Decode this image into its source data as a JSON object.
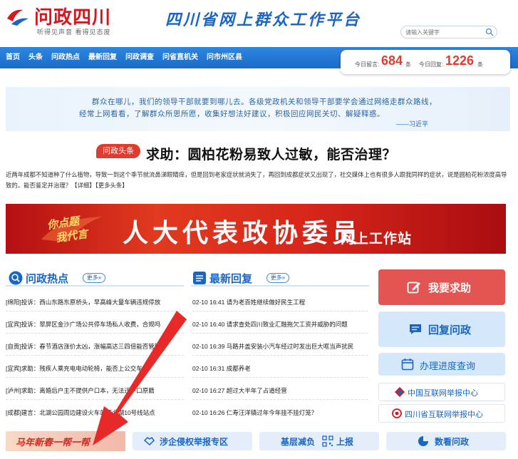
{
  "header": {
    "logo_title": "问政四川",
    "logo_sub": "听得见声音 看得见态度",
    "slogan": "四川省网上群众工作平台",
    "search_placeholder": "请输入关键字"
  },
  "nav": {
    "items": [
      "首页",
      "头条",
      "问政热点",
      "最新回复",
      "问政调查",
      "问省直机关",
      "问市州区县"
    ]
  },
  "stats": {
    "today_msg_label": "今日留言:",
    "today_msg_value": "684",
    "today_msg_unit": "条",
    "today_reply_label": "今日回复:",
    "today_reply_value": "1226",
    "today_reply_unit": "条"
  },
  "quote": {
    "line1": "群众在哪儿，我们的领导干部就要到哪儿去。各级党政机关和领导干部要学会通过网络走群众路线，",
    "line2": "经常上网看看，了解群众所思所愿，收集好想法好建议，积极回应网民关切、解疑释惑。",
    "author": "——习近平"
  },
  "headline": {
    "badge": "问政头条",
    "title": "求助：圆柏花粉易致人过敏，能否治理？",
    "summary": "近两年成都不知道种了什么植物，导致一到这个季节就流鼻涕眼睛痒，但是回到老家症状就消失了，再回到成都症状又出现了，社交媒体上也有很多人跟我同样的症状，说是圆柏花粉浓度高导致的。能否鉴定并治理？",
    "detail_link": "【详细】",
    "more_link": "【更多头条】"
  },
  "banner": {
    "slogan_1": "你点题",
    "slogan_2": "我代言",
    "title": "人大代表政协委员",
    "subtitle": "网上工作站"
  },
  "hot": {
    "title": "问政热点",
    "more": "更多»",
    "items": [
      "[绵阳]投诉：西山东路东原桥头，早高峰大量车辆违规停放",
      "[宜宾]投诉：翠屏区金沙广场公共停车场私人收费，合规吗",
      "[自贡]投诉：春节酒店涨价太凶，涨幅高达三四倍能否管管",
      "[宜宾]求助：残疾人乘充电电动轮椅，能否上公交车？",
      "[泸州]求助：离婚后户主不提供户口本，无法迁户口原籍",
      "[成都]建言：北湖公园周边建设火车站至北湖10号线站点"
    ]
  },
  "latest": {
    "title": "最新回复",
    "more": "更多»",
    "items": [
      "02-10 16:41 请为老百姓继续做好民生工程",
      "02-10 16:40 请求查处四川致业汇融拖欠工资并威胁的问题",
      "02-10 16:39 马路井盖安装小汽车经过时发出巨大哐当声扰民",
      "02-10 16:31 成都养老",
      "02-10 16:27 超过大半年了占道经营",
      "02-10 16:26 仁寿汪洋镇过年今年挂不挂灯笼？"
    ]
  },
  "right": {
    "ask_button": "我要求助",
    "reply_button": "回复问政",
    "progress_button": "办理进度查询",
    "link_cn_report": "中国互联网举报中心",
    "link_sc_report": "四川省互联网举报中心"
  },
  "bottom": {
    "promo": "马年新春一帮一帮",
    "enterprise": "涉企侵权举报专区",
    "grassroots": "基层减负",
    "grassroots_suffix": "上报",
    "data": "数看问政"
  },
  "colors": {
    "brand_red": "#d4181f",
    "brand_blue": "#1a66c4",
    "nav_blue": "#1a6cc8",
    "accent_red": "#e25552"
  }
}
